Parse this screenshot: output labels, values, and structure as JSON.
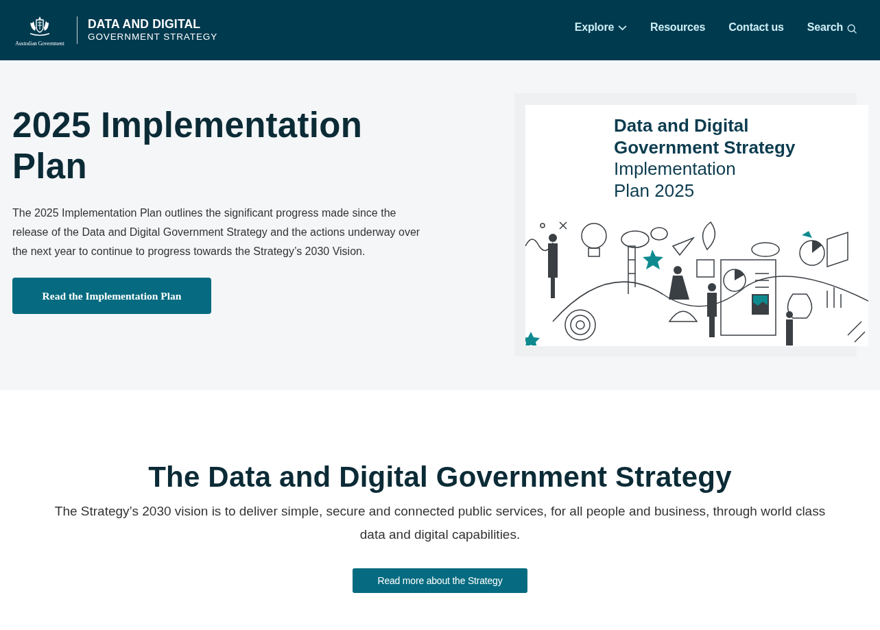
{
  "header": {
    "logo": {
      "caption": "Australian Government",
      "title": "DATA AND DIGITAL",
      "subtitle": "GOVERNMENT STRATEGY"
    },
    "nav": [
      {
        "label": "Explore",
        "kind": "dropdown"
      },
      {
        "label": "Resources",
        "kind": "link"
      },
      {
        "label": "Contact us",
        "kind": "link"
      },
      {
        "label": "Search",
        "kind": "search"
      }
    ]
  },
  "hero": {
    "title": "2025 Implementation Plan",
    "description": "The 2025 Implementation Plan outlines the significant progress made since the release of the Data and Digital Government Strategy and the actions underway over the next year to continue to progress towards the Strategy’s 2030 Vision.",
    "button": "Read the Implementation Plan",
    "cover": {
      "title_lines": [
        "Data and Digital",
        "Government Strategy"
      ],
      "subtitle_lines": [
        "Implementation",
        "Plan 2025"
      ]
    }
  },
  "strategy": {
    "title": "The Data and Digital Government Strategy",
    "description": "The Strategy’s 2030 vision is to deliver simple, secure and connected public services, for all people and business, through world class data and digital capabilities.",
    "button": "Read more about the Strategy"
  }
}
